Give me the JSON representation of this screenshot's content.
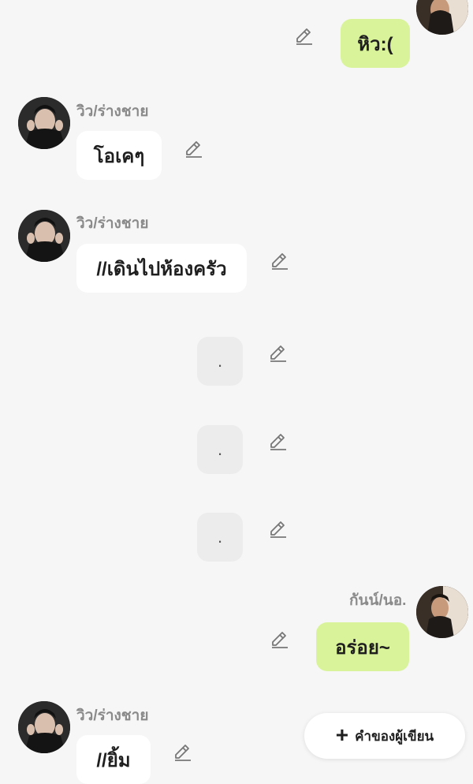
{
  "messages": [
    {
      "sender": "",
      "side": "right",
      "text": "หิว:(",
      "style": "green"
    },
    {
      "sender": "วิว/ร่างชาย",
      "side": "left",
      "text": "โอเคๆ",
      "style": "white"
    },
    {
      "sender": "วิว/ร่างชาย",
      "side": "left",
      "text": "//เดินไปห้องครัว",
      "style": "white"
    },
    {
      "sender": "",
      "side": "center",
      "text": ".",
      "style": "gray"
    },
    {
      "sender": "",
      "side": "center",
      "text": ".",
      "style": "gray"
    },
    {
      "sender": "",
      "side": "center",
      "text": ".",
      "style": "gray"
    },
    {
      "sender": "กันน์/นอ.",
      "side": "right",
      "text": "อร่อย~",
      "style": "green"
    },
    {
      "sender": "วิว/ร่างชาย",
      "side": "left",
      "text": "//ยิ้ม",
      "style": "white"
    }
  ],
  "icons": {
    "edit": "pencil-edit-icon",
    "add": "plus-icon"
  },
  "fab": {
    "label": "คำของผู้เขียน",
    "plus": "+"
  },
  "colors": {
    "background": "#f6f6f6",
    "bubble_user": "#d9f39a",
    "bubble_other": "#ffffff",
    "bubble_narration": "#ececec",
    "sender_name": "#8a8a8a"
  }
}
